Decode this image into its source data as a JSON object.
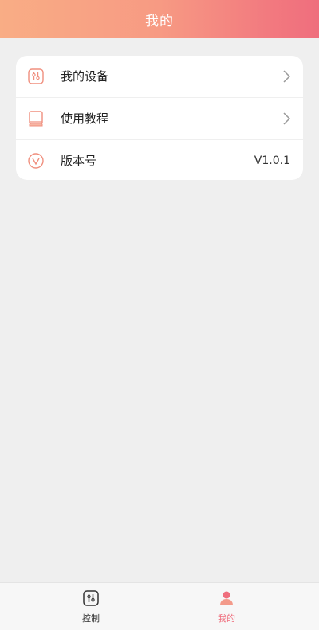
{
  "header": {
    "title": "我的"
  },
  "menu": {
    "items": [
      {
        "label": "我的设备",
        "icon": "device-icon",
        "has_chevron": true
      },
      {
        "label": "使用教程",
        "icon": "book-icon",
        "has_chevron": true
      },
      {
        "label": "版本号",
        "icon": "version-icon",
        "value": "V1.0.1"
      }
    ]
  },
  "tabbar": {
    "tabs": [
      {
        "label": "控制",
        "icon": "control-icon",
        "active": false
      },
      {
        "label": "我的",
        "icon": "user-icon",
        "active": true
      }
    ]
  },
  "colors": {
    "accent": "#ef6e7d",
    "header_gradient_start": "#f9ad85",
    "header_gradient_end": "#ef6e7d",
    "background": "#efefef"
  }
}
